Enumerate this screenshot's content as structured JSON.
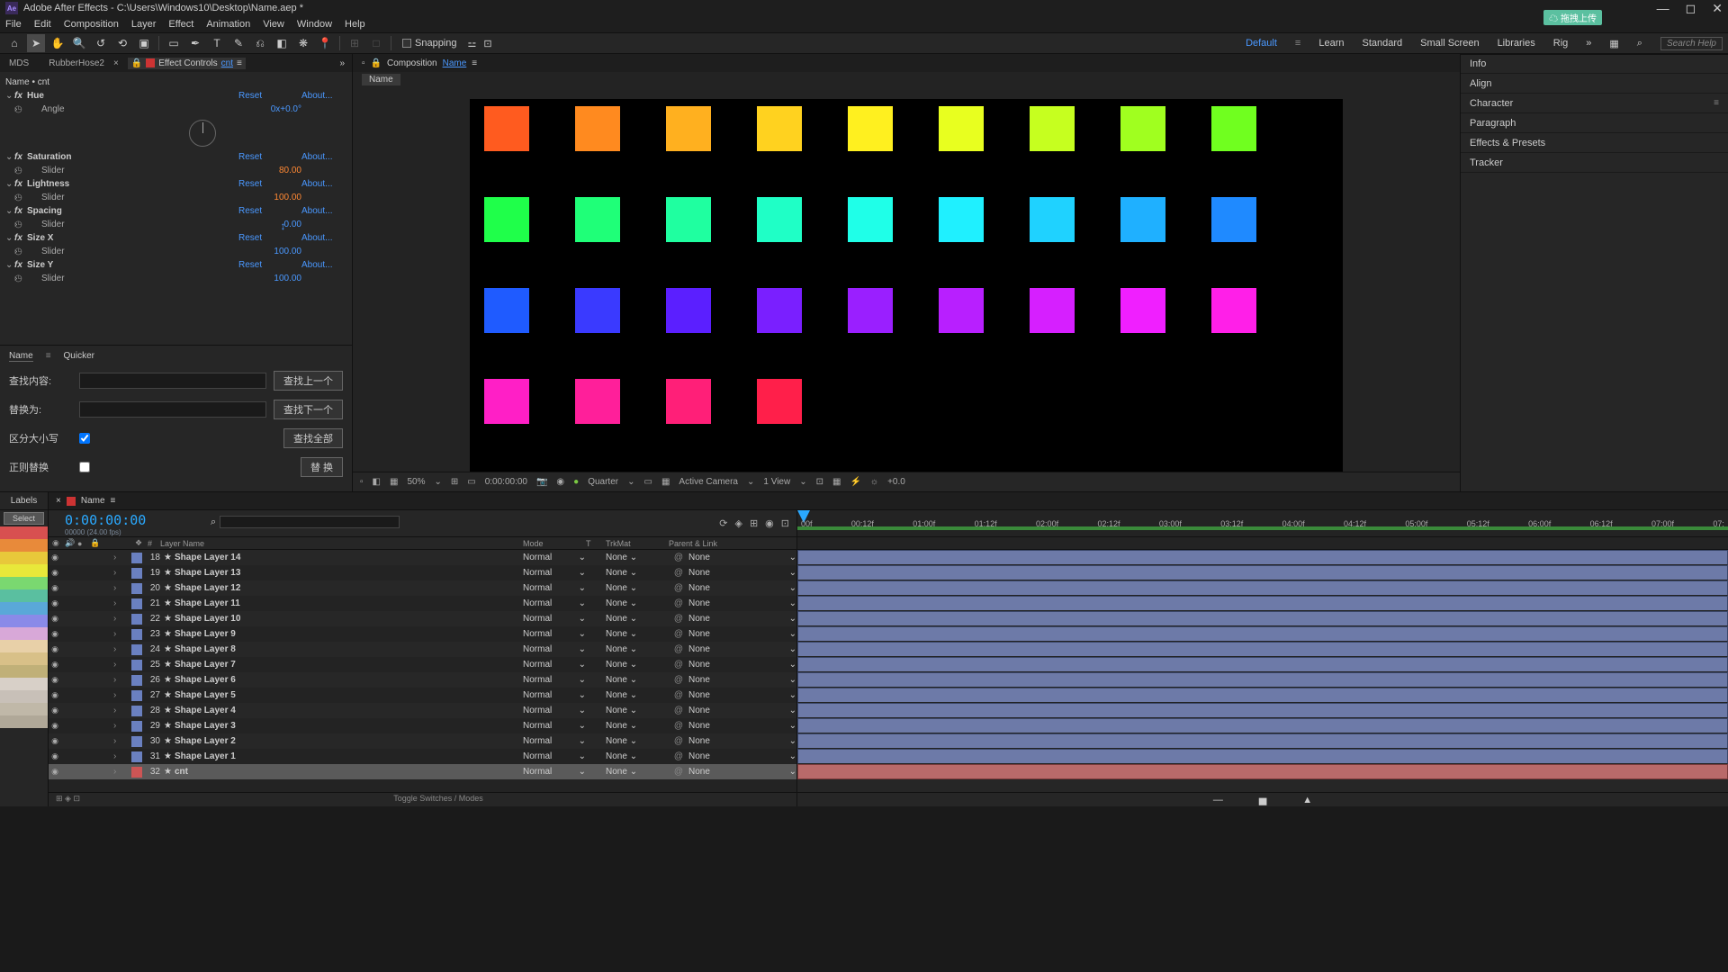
{
  "title": "Adobe After Effects - C:\\Users\\Windows10\\Desktop\\Name.aep *",
  "menu": [
    "File",
    "Edit",
    "Composition",
    "Layer",
    "Effect",
    "Animation",
    "View",
    "Window",
    "Help"
  ],
  "snapping": "Snapping",
  "workspaces": {
    "default": "Default",
    "learn": "Learn",
    "standard": "Standard",
    "small": "Small Screen",
    "libraries": "Libraries",
    "rig": "Rig"
  },
  "search_help": "Search Help",
  "upload_pill": "拖拽上传",
  "ec": {
    "tabs": {
      "mds": "MDS",
      "rubber": "RubberHose2",
      "label": "Effect Controls",
      "layer": "cnt"
    },
    "header": "Name • cnt",
    "effects": [
      {
        "name": "Hue",
        "reset": "Reset",
        "about": "About...",
        "sub": "Angle",
        "val": "0x+0.0°",
        "angle": true
      },
      {
        "name": "Saturation",
        "reset": "Reset",
        "about": "About...",
        "sub": "Slider",
        "val": "80.00",
        "orange": true
      },
      {
        "name": "Lightness",
        "reset": "Reset",
        "about": "About...",
        "sub": "Slider",
        "val": "100.00",
        "orange": true
      },
      {
        "name": "Spacing",
        "reset": "Reset",
        "about": "About...",
        "sub": "Slider",
        "val": "0.00",
        "cursor": true
      },
      {
        "name": "Size X",
        "reset": "Reset",
        "about": "About...",
        "sub": "Slider",
        "val": "100.00"
      },
      {
        "name": "Size Y",
        "reset": "Reset",
        "about": "About...",
        "sub": "Slider",
        "val": "100.00"
      }
    ]
  },
  "find": {
    "tab1": "Name",
    "tab2": "Quicker",
    "find_label": "查找内容:",
    "find_btn": "查找上一个",
    "repl_label": "替换为:",
    "repl_btn": "查找下一个",
    "case_label": "区分大小写",
    "case_btn": "查找全部",
    "regex_label": "正则替换",
    "regex_btn": "替 换"
  },
  "comp": {
    "tabs_label": "Composition",
    "comp_name": "Name",
    "breadcrumb": "Name",
    "zoom": "50%",
    "time": "0:00:00:00",
    "quality": "Quarter",
    "camera": "Active Camera",
    "view": "1 View",
    "plus": "+0.0"
  },
  "squares": [
    {
      "r": 0,
      "c": 0,
      "col": "#ff5b1f"
    },
    {
      "r": 0,
      "c": 1,
      "col": "#ff8a1f"
    },
    {
      "r": 0,
      "c": 2,
      "col": "#ffb01f"
    },
    {
      "r": 0,
      "c": 3,
      "col": "#ffd21f"
    },
    {
      "r": 0,
      "c": 4,
      "col": "#fff01f"
    },
    {
      "r": 0,
      "c": 5,
      "col": "#e8ff1f"
    },
    {
      "r": 0,
      "c": 6,
      "col": "#c6ff1f"
    },
    {
      "r": 0,
      "c": 7,
      "col": "#a0ff1f"
    },
    {
      "r": 0,
      "c": 8,
      "col": "#70ff1f"
    },
    {
      "r": 1,
      "c": 0,
      "col": "#1fff4a"
    },
    {
      "r": 1,
      "c": 1,
      "col": "#1fff78"
    },
    {
      "r": 1,
      "c": 2,
      "col": "#1fffa0"
    },
    {
      "r": 1,
      "c": 3,
      "col": "#1fffc6"
    },
    {
      "r": 1,
      "c": 4,
      "col": "#1fffe8"
    },
    {
      "r": 1,
      "c": 5,
      "col": "#1ff0ff"
    },
    {
      "r": 1,
      "c": 6,
      "col": "#1fd2ff"
    },
    {
      "r": 1,
      "c": 7,
      "col": "#1fb0ff"
    },
    {
      "r": 1,
      "c": 8,
      "col": "#1f8aff"
    },
    {
      "r": 2,
      "c": 0,
      "col": "#1f5bff"
    },
    {
      "r": 2,
      "c": 1,
      "col": "#3a3aff"
    },
    {
      "r": 2,
      "c": 2,
      "col": "#5b1fff"
    },
    {
      "r": 2,
      "c": 3,
      "col": "#7a1fff"
    },
    {
      "r": 2,
      "c": 4,
      "col": "#9a1fff"
    },
    {
      "r": 2,
      "c": 5,
      "col": "#b81fff"
    },
    {
      "r": 2,
      "c": 6,
      "col": "#d61fff"
    },
    {
      "r": 2,
      "c": 7,
      "col": "#f01fff"
    },
    {
      "r": 2,
      "c": 8,
      "col": "#ff1fe8"
    },
    {
      "r": 3,
      "c": 0,
      "col": "#ff1fc6"
    },
    {
      "r": 3,
      "c": 1,
      "col": "#ff1f9a"
    },
    {
      "r": 3,
      "c": 2,
      "col": "#ff1f78"
    },
    {
      "r": 3,
      "c": 3,
      "col": "#ff1f4a"
    }
  ],
  "right_panels": [
    "Info",
    "Align",
    "Character",
    "Paragraph",
    "Effects & Presets",
    "Tracker"
  ],
  "timeline": {
    "labels_hdr": "Labels",
    "select": "Select",
    "label_colors": [
      "#d85050",
      "#e88a3a",
      "#e8c83a",
      "#e8e83a",
      "#7ad870",
      "#5abfa0",
      "#5aa8d8",
      "#8a8ae8",
      "#d8a8d8",
      "#e8d0a8",
      "#d8c088",
      "#c0b078",
      "#d8d0c8",
      "#c8c0b8",
      "#c0b8a8",
      "#b0a898"
    ],
    "tab": "Name",
    "time": "0:00:00:00",
    "time_sub": "00000 (24.00 fps)",
    "col_layer": "Layer Name",
    "col_mode": "Mode",
    "col_t": "T",
    "col_trk": "TrkMat",
    "col_parent": "Parent & Link",
    "ruler": [
      "00f",
      "00:12f",
      "01:00f",
      "01:12f",
      "02:00f",
      "02:12f",
      "03:00f",
      "03:12f",
      "04:00f",
      "04:12f",
      "05:00f",
      "05:12f",
      "06:00f",
      "06:12f",
      "07:00f",
      "07:"
    ],
    "rows": [
      {
        "n": 18,
        "name": "Shape Layer 14",
        "mode": "Normal",
        "trk": "None",
        "parent": "None"
      },
      {
        "n": 19,
        "name": "Shape Layer 13",
        "mode": "Normal",
        "trk": "None",
        "parent": "None"
      },
      {
        "n": 20,
        "name": "Shape Layer 12",
        "mode": "Normal",
        "trk": "None",
        "parent": "None"
      },
      {
        "n": 21,
        "name": "Shape Layer 11",
        "mode": "Normal",
        "trk": "None",
        "parent": "None"
      },
      {
        "n": 22,
        "name": "Shape Layer 10",
        "mode": "Normal",
        "trk": "None",
        "parent": "None"
      },
      {
        "n": 23,
        "name": "Shape Layer 9",
        "mode": "Normal",
        "trk": "None",
        "parent": "None"
      },
      {
        "n": 24,
        "name": "Shape Layer 8",
        "mode": "Normal",
        "trk": "None",
        "parent": "None"
      },
      {
        "n": 25,
        "name": "Shape Layer 7",
        "mode": "Normal",
        "trk": "None",
        "parent": "None"
      },
      {
        "n": 26,
        "name": "Shape Layer 6",
        "mode": "Normal",
        "trk": "None",
        "parent": "None"
      },
      {
        "n": 27,
        "name": "Shape Layer 5",
        "mode": "Normal",
        "trk": "None",
        "parent": "None"
      },
      {
        "n": 28,
        "name": "Shape Layer 4",
        "mode": "Normal",
        "trk": "None",
        "parent": "None"
      },
      {
        "n": 29,
        "name": "Shape Layer 3",
        "mode": "Normal",
        "trk": "None",
        "parent": "None"
      },
      {
        "n": 30,
        "name": "Shape Layer 2",
        "mode": "Normal",
        "trk": "None",
        "parent": "None"
      },
      {
        "n": 31,
        "name": "Shape Layer 1",
        "mode": "Normal",
        "trk": "None",
        "parent": "None"
      },
      {
        "n": 32,
        "name": "cnt",
        "mode": "Normal",
        "trk": "None",
        "parent": "None",
        "sel": true,
        "red": true
      }
    ],
    "toggle": "Toggle Switches / Modes"
  }
}
